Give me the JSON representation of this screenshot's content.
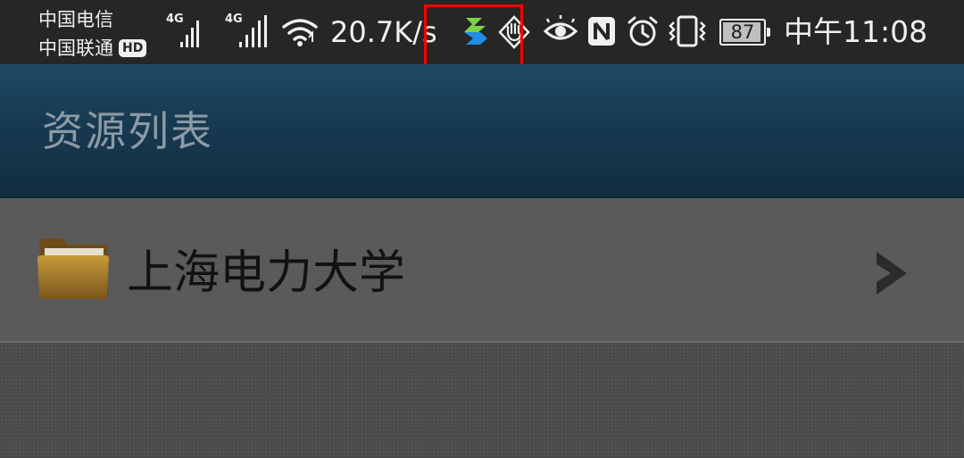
{
  "status_bar": {
    "carrier_1": "中国电信",
    "carrier_2": "中国联通",
    "hd_badge": "HD",
    "network_1": "4G",
    "network_2": "4G",
    "net_speed": "20.7K/s",
    "battery_level": "87",
    "time": "中午11:08",
    "icons": [
      "signal-icon",
      "wifi-icon",
      "app-notification-icon",
      "gesture-hand-icon",
      "eye-icon",
      "nfc-icon",
      "alarm-icon",
      "vibrate-icon",
      "battery-icon"
    ],
    "highlight_color": "#ff0000"
  },
  "title_bar": {
    "title": "资源列表"
  },
  "list": {
    "items": [
      {
        "icon": "folder-icon",
        "label": "上海电力大学",
        "trailing_icon": "chevron-right-icon"
      }
    ]
  },
  "colors": {
    "status_bar_bg": "#262626",
    "title_bar_bg": "#173a51",
    "list_item_bg": "#5a5a5a"
  }
}
